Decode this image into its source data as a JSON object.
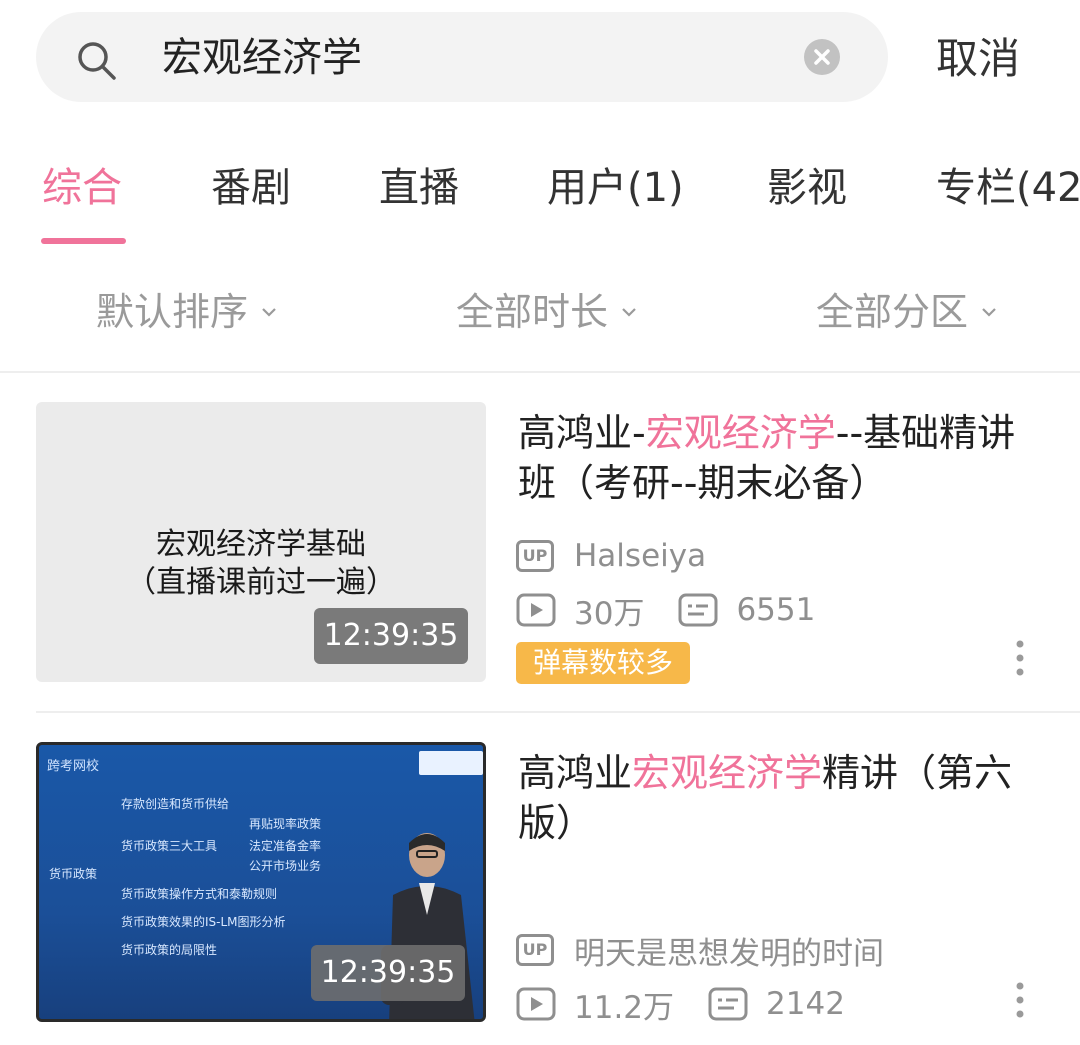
{
  "search": {
    "query": "宏观经济学",
    "cancel_label": "取消"
  },
  "tabs": [
    {
      "label": "综合",
      "active": true
    },
    {
      "label": "番剧"
    },
    {
      "label": "直播"
    },
    {
      "label": "用户(1)"
    },
    {
      "label": "影视"
    },
    {
      "label": "专栏(42"
    }
  ],
  "filters": [
    {
      "label": "默认排序"
    },
    {
      "label": "全部时长"
    },
    {
      "label": "全部分区"
    }
  ],
  "colors": {
    "accent": "#f0739a",
    "badge": "#f7b849",
    "meta": "#8f8f8f"
  },
  "videos": [
    {
      "title_pre": "高鸿业-",
      "title_hl": "宏观经济学",
      "title_post": "--基础精讲班（考研--期末必备）",
      "thumb_text_line1": "宏观经济学基础",
      "thumb_text_line2": "（直播课前过一遍）",
      "duration": "12:39:35",
      "up_label": "UP",
      "uploader": "Halseiya",
      "views": "30万",
      "danmaku": "6551",
      "badge": "弹幕数较多"
    },
    {
      "title_pre": "高鸿业",
      "title_hl": "宏观经济学",
      "title_post": "精讲（第六版）",
      "duration": "12:39:35",
      "up_label": "UP",
      "uploader": "明天是思想发明的时间",
      "views": "11.2万",
      "danmaku": "2142",
      "slide": {
        "logo": "跨考网校",
        "lines": [
          "存款创造和货币供给",
          "再贴现率政策",
          "货币政策三大工具",
          "法定准备金率",
          "公开市场业务",
          "货币政策",
          "货币政策操作方式和泰勒规则",
          "货币政策效果的IS-LM图形分析",
          "货币政策的局限性"
        ]
      }
    }
  ]
}
